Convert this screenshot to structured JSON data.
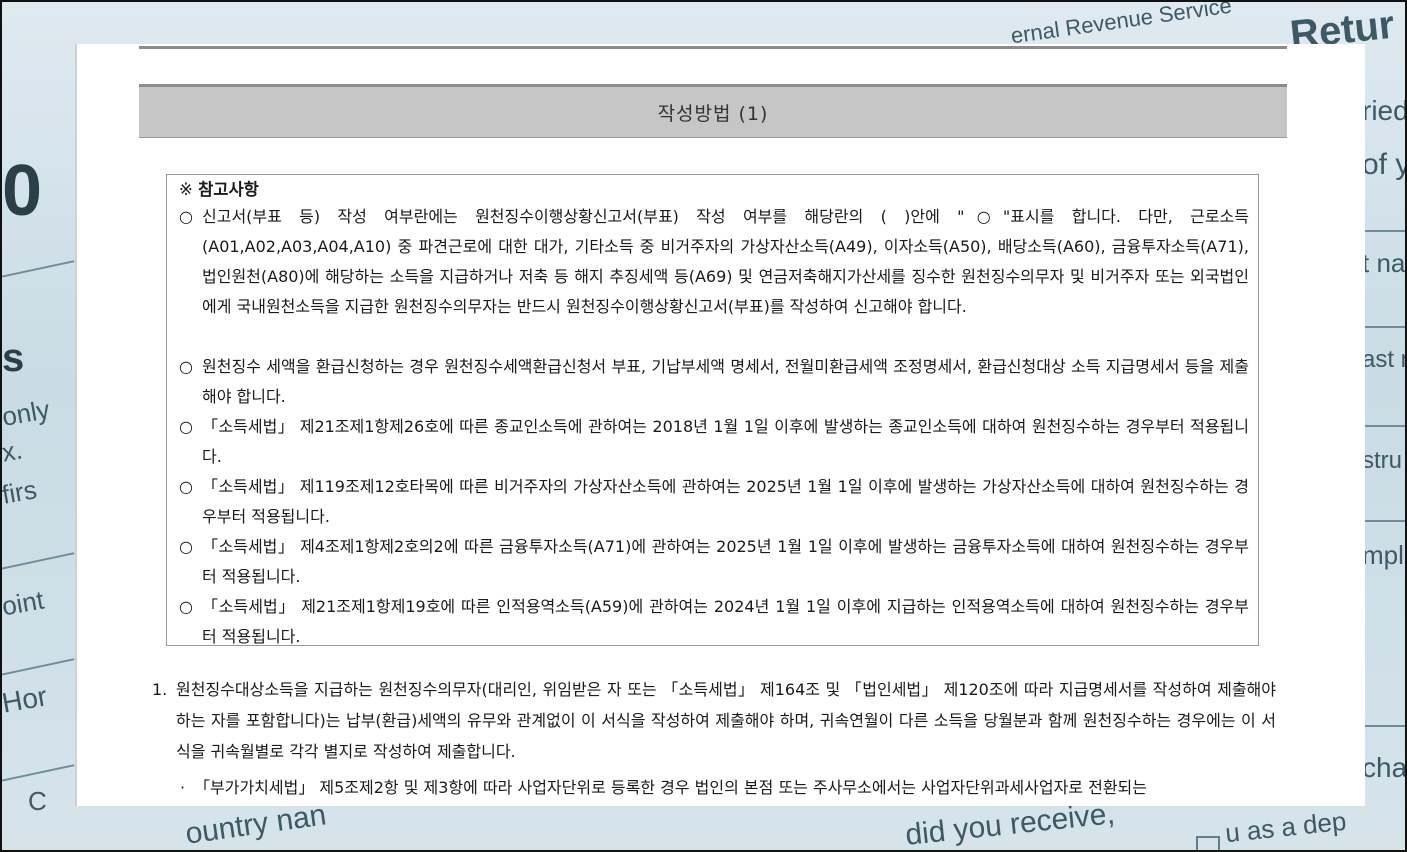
{
  "background": {
    "fragments": [
      "ernal Revenue Service",
      "Retur",
      "ried",
      "of y",
      "t na",
      "ast n",
      "stru",
      "mple",
      "cha",
      "u as a dep",
      "did you receive,",
      "ountry nan",
      "0",
      "s",
      "only",
      "x.",
      "firs",
      "oint",
      "Hor",
      "C"
    ]
  },
  "document": {
    "section_title": "작성방법 (1)",
    "notes_heading_mark": "※",
    "notes_heading": "참고사항",
    "bullet": "○",
    "notes": [
      "신고서(부표 등) 작성 여부란에는 원천징수이행상황신고서(부표) 작성 여부를 해당란의 ( )안에 \"○\"표시를 합니다. 다만, 근로소득(A01,A02,A03,A04,A10) 중 파견근로에 대한 대가, 기타소득 중 비거주자의 가상자산소득(A49), 이자소득(A50), 배당소득(A60), 금융투자소득(A71), 법인원천(A80)에 해당하는 소득을 지급하거나 저축 등 해지 추징세액 등(A69) 및 연금저축해지가산세를 징수한 원천징수의무자 및 비거주자 또는 외국법인에게 국내원천소득을 지급한 원천징수의무자는 반드시 원천징수이행상황신고서(부표)를 작성하여 신고해야 합니다.",
      "원천징수 세액을 환급신청하는 경우 원천징수세액환급신청서 부표, 기납부세액 명세서, 전월미환급세액 조정명세서, 환급신청대상 소득 지급명세서 등을 제출해야 합니다.",
      "「소득세법」 제21조제1항제26호에 따른 종교인소득에 관하여는 2018년 1월 1일 이후에 발생하는 종교인소득에 대하여 원천징수하는 경우부터 적용됩니다.",
      "「소득세법」 제119조제12호타목에 따른 비거주자의 가상자산소득에 관하여는 2025년 1월 1일 이후에 발생하는 가상자산소득에 대하여 원천징수하는 경우부터 적용됩니다.",
      "「소득세법」 제4조제1항제2호의2에 따른 금융투자소득(A71)에 관하여는 2025년 1월 1일 이후에 발생하는 금융투자소득에 대하여 원천징수하는 경우부터 적용됩니다.",
      "「소득세법」 제21조제1항제19호에 따른 인적용역소득(A59)에 관하여는 2024년 1월 1일 이후에 지급하는 인적용역소득에 대하여 원천징수하는 경우부터 적용됩니다."
    ],
    "instructions": [
      {
        "number": "1.",
        "text": "원천징수대상소득을 지급하는 원천징수의무자(대리인, 위임받은 자 또는 「소득세법」 제164조 및 「법인세법」 제120조에 따라 지급명세서를 작성하여 제출해야 하는 자를 포함합니다)는 납부(환급)세액의 유무와 관계없이 이 서식을 작성하여 제출해야 하며, 귀속연월이 다른 소득을 당월분과 함께 원천징수하는 경우에는 이 서식을 귀속월별로 각각 별지로 작성하여 제출합니다."
      }
    ],
    "sub_item": {
      "marker": "·",
      "text": "「부가가치세법」 제5조제2항 및 제3항에 따라 사업자단위로 등록한 경우 법인의 본점 또는 주사무소에서는 사업자단위과세사업자로 전환되는"
    }
  }
}
